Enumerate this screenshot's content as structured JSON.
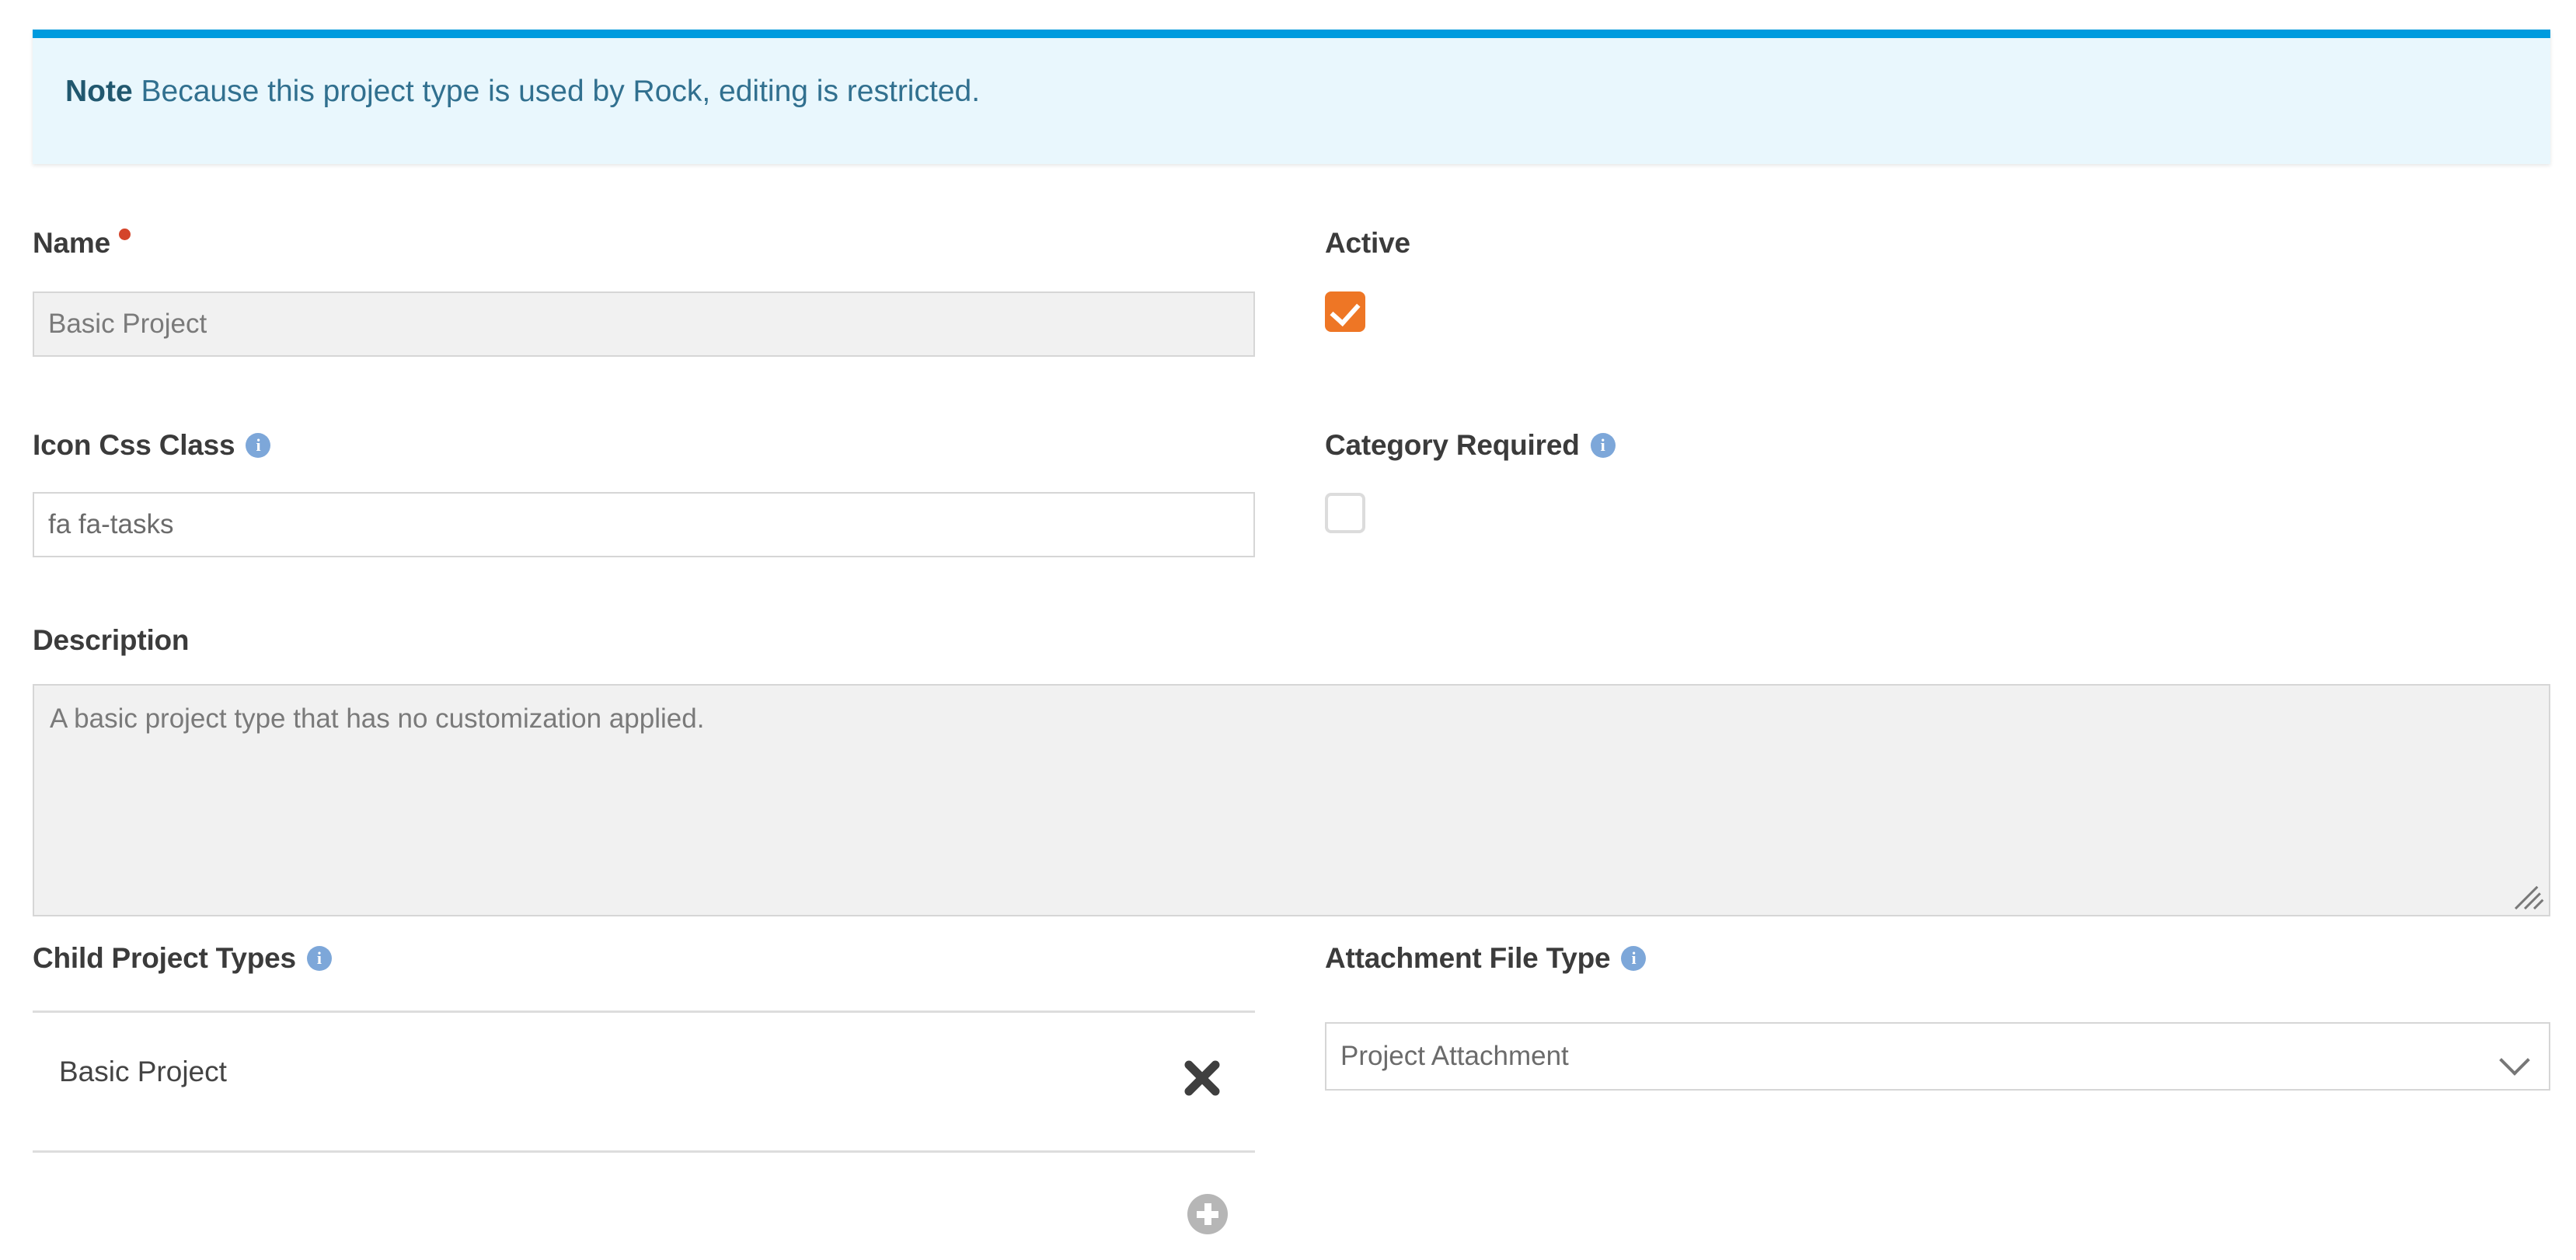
{
  "note": {
    "strong": "Note",
    "text": "Because this project type is used by Rock, editing is restricted.",
    "accent_color": "#009bde",
    "background_color": "#e9f7fd",
    "text_color": "#31708f"
  },
  "form": {
    "name": {
      "label": "Name",
      "value": "Basic Project",
      "required": true,
      "disabled": true
    },
    "icon_css_class": {
      "label": "Icon Css Class",
      "value": "fa fa-tasks",
      "info_icon": "info-icon"
    },
    "active": {
      "label": "Active",
      "checked": true,
      "checkbox_color": "#ee7625"
    },
    "category_required": {
      "label": "Category Required",
      "checked": false,
      "info_icon": "info-icon"
    },
    "description": {
      "label": "Description",
      "value": "A basic project type that has no customization applied.",
      "disabled": true
    },
    "child_project_types": {
      "label": "Child Project Types",
      "info_icon": "info-icon",
      "items": [
        {
          "label": "Basic Project",
          "remove_icon": "close-icon"
        }
      ],
      "add_icon": "plus-circle-icon"
    },
    "attachment_file_type": {
      "label": "Attachment File Type",
      "info_icon": "info-icon",
      "selected": "Project Attachment",
      "chevron_icon": "chevron-down-icon"
    }
  },
  "glyphs": {
    "info": "i"
  }
}
